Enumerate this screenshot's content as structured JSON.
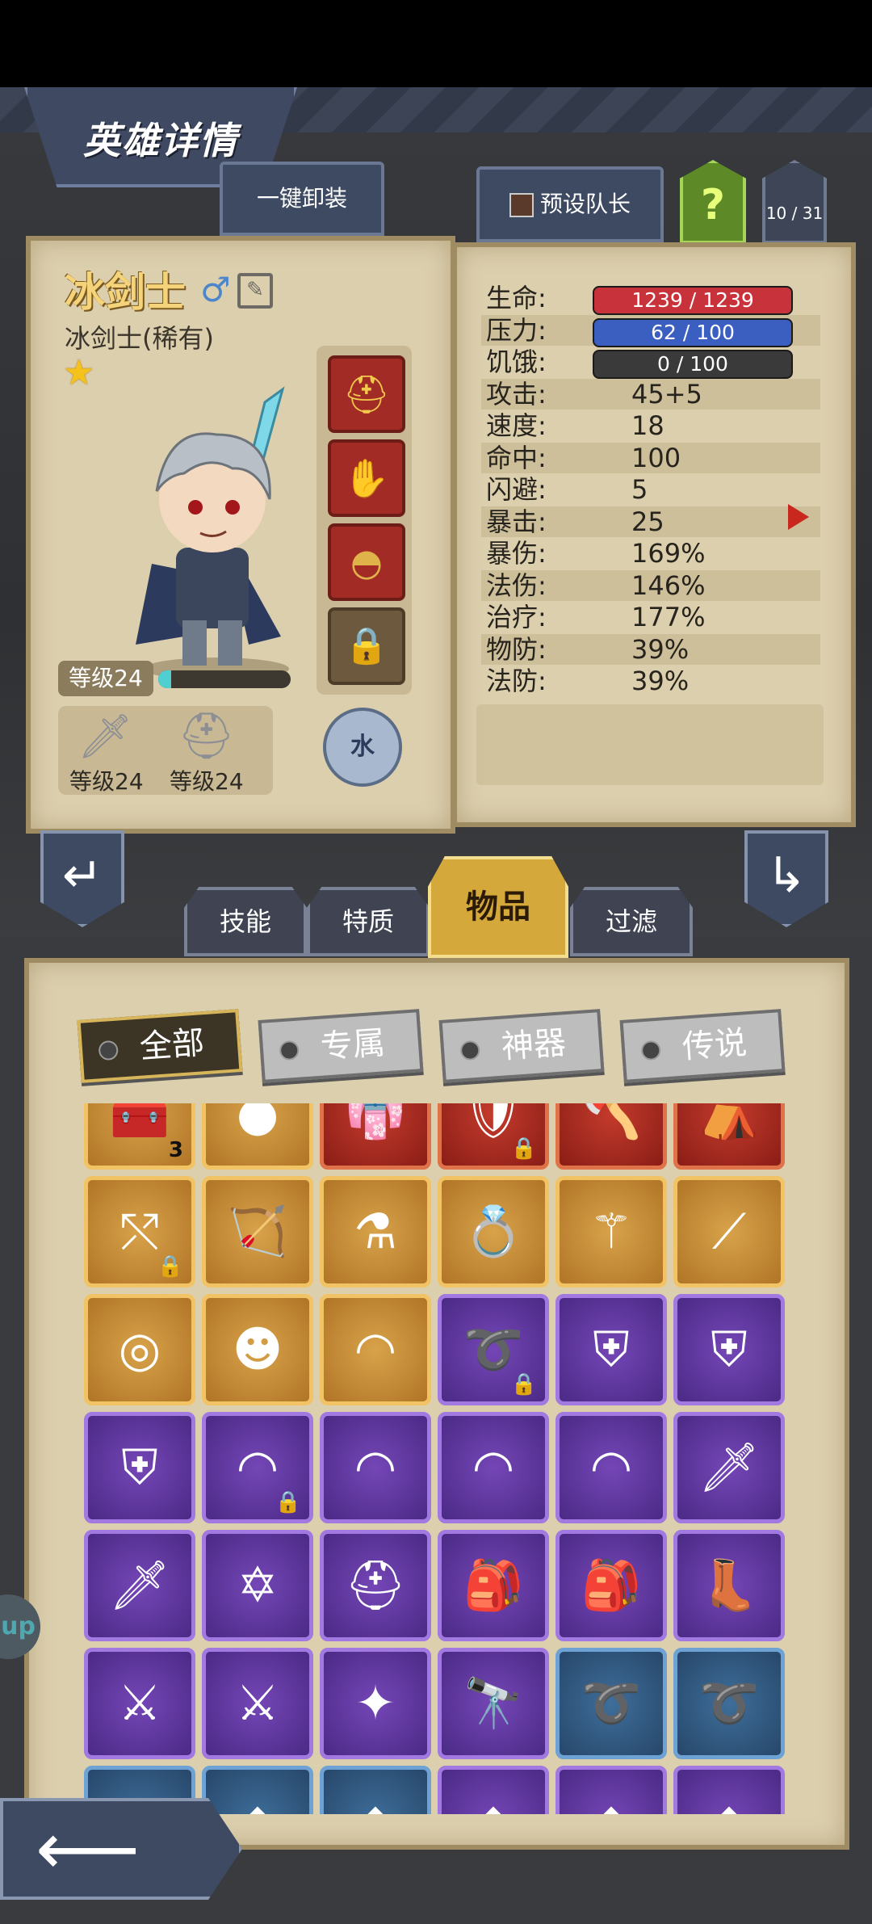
{
  "header": {
    "title": "英雄详情"
  },
  "toolbar": {
    "unequip_all": "一键卸装",
    "preset_leader": "预设队长",
    "help": "?",
    "hero_count": "10 / 31"
  },
  "hero": {
    "name": "冰剑士",
    "class_rarity": "冰剑士(稀有)",
    "level": "等级24",
    "exp_fraction": 0.1,
    "element": "水",
    "weapon_level": "等级24",
    "armor_level": "等级24",
    "equip_slots": [
      {
        "icon": "golden-helmet-icon",
        "locked": true
      },
      {
        "icon": "spiked-gauntlet-icon",
        "locked": false
      },
      {
        "icon": "hood-icon",
        "locked": false
      },
      {
        "icon": "lock-icon",
        "locked": true
      }
    ]
  },
  "stats": {
    "rows": [
      {
        "label": "生命:",
        "value": "1239 / 1239",
        "bar": "red"
      },
      {
        "label": "压力:",
        "value": "62 / 100",
        "bar": "blue"
      },
      {
        "label": "饥饿:",
        "value": "0 / 100",
        "bar": "dark"
      },
      {
        "label": "攻击:",
        "value": "45+5"
      },
      {
        "label": "速度:",
        "value": "18"
      },
      {
        "label": "命中:",
        "value": "100"
      },
      {
        "label": "闪避:",
        "value": "5"
      },
      {
        "label": "暴击:",
        "value": "25"
      },
      {
        "label": "暴伤:",
        "value": "169%"
      },
      {
        "label": "法伤:",
        "value": "146%"
      },
      {
        "label": "治疗:",
        "value": "177%"
      },
      {
        "label": "物防:",
        "value": "39%"
      },
      {
        "label": "法防:",
        "value": "39%"
      }
    ]
  },
  "tabs": [
    "技能",
    "特质",
    "物品",
    "过滤"
  ],
  "active_tab": "物品",
  "filters": [
    "全部",
    "专属",
    "神器",
    "传说"
  ],
  "active_filter": "全部",
  "inventory": [
    {
      "rarity": "orange",
      "icon": "chest-icon",
      "count": "3"
    },
    {
      "rarity": "orange",
      "icon": "green-orb-icon"
    },
    {
      "rarity": "red",
      "icon": "robe-icon"
    },
    {
      "rarity": "red",
      "icon": "shield-icon",
      "locked": true
    },
    {
      "rarity": "red",
      "icon": "axe-icon"
    },
    {
      "rarity": "red",
      "icon": "cape-icon"
    },
    {
      "rarity": "orange",
      "icon": "crossbow-icon",
      "locked": true
    },
    {
      "rarity": "orange",
      "icon": "bow-icon"
    },
    {
      "rarity": "orange",
      "icon": "potion-icon"
    },
    {
      "rarity": "orange",
      "icon": "ruby-ring-icon"
    },
    {
      "rarity": "orange",
      "icon": "staff-icon"
    },
    {
      "rarity": "orange",
      "icon": "wand-icon"
    },
    {
      "rarity": "orange",
      "icon": "jade-ring-icon"
    },
    {
      "rarity": "orange",
      "icon": "voodoo-doll-icon"
    },
    {
      "rarity": "orange",
      "icon": "belt-icon"
    },
    {
      "rarity": "purple",
      "icon": "whip-icon",
      "locked": true
    },
    {
      "rarity": "purple",
      "icon": "armor-icon"
    },
    {
      "rarity": "purple",
      "icon": "armor-icon"
    },
    {
      "rarity": "purple",
      "icon": "armor-icon"
    },
    {
      "rarity": "purple",
      "icon": "belt-icon",
      "locked": true
    },
    {
      "rarity": "purple",
      "icon": "belt-icon"
    },
    {
      "rarity": "purple",
      "icon": "belt-icon"
    },
    {
      "rarity": "purple",
      "icon": "belt-icon"
    },
    {
      "rarity": "purple",
      "icon": "sword-icon"
    },
    {
      "rarity": "purple",
      "icon": "sword-icon"
    },
    {
      "rarity": "purple",
      "icon": "hexagram-amulet-icon"
    },
    {
      "rarity": "purple",
      "icon": "helmet-icon"
    },
    {
      "rarity": "purple",
      "icon": "backpack-icon"
    },
    {
      "rarity": "purple",
      "icon": "backpack-icon"
    },
    {
      "rarity": "purple",
      "icon": "boots-icon"
    },
    {
      "rarity": "purple",
      "icon": "scimitar-icon"
    },
    {
      "rarity": "purple",
      "icon": "scimitar-icon"
    },
    {
      "rarity": "purple",
      "icon": "crystal-staff-icon"
    },
    {
      "rarity": "purple",
      "icon": "spyglass-icon"
    },
    {
      "rarity": "blue",
      "icon": "whip-icon"
    },
    {
      "rarity": "blue",
      "icon": "whip-icon"
    },
    {
      "rarity": "blue",
      "icon": "item-icon"
    },
    {
      "rarity": "blue",
      "icon": "item-icon"
    },
    {
      "rarity": "blue",
      "icon": "item-icon"
    },
    {
      "rarity": "purple",
      "icon": "item-icon"
    },
    {
      "rarity": "purple",
      "icon": "item-icon"
    },
    {
      "rarity": "purple",
      "icon": "item-icon"
    }
  ],
  "side_pill": "up",
  "colors": {
    "hp": "#c8323a",
    "stress": "#3a5fc0",
    "hunger": "#3a3a3a",
    "accent": "#d4a83a"
  }
}
